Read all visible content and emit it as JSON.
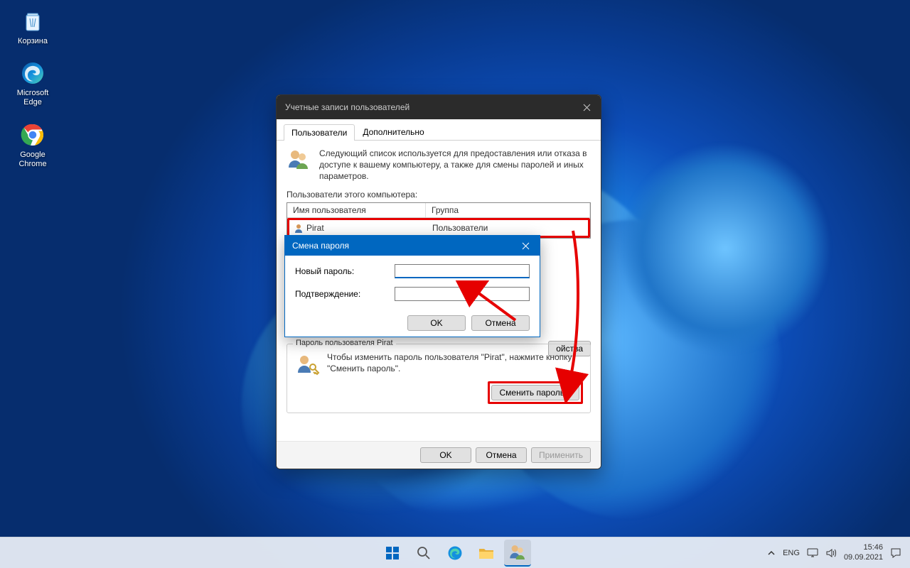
{
  "desktop": {
    "icons": [
      {
        "name": "recycle-bin",
        "label": "Корзина"
      },
      {
        "name": "edge",
        "label": "Microsoft Edge"
      },
      {
        "name": "chrome",
        "label": "Google Chrome"
      }
    ]
  },
  "mainWindow": {
    "title": "Учетные записи пользователей",
    "tabs": {
      "users": "Пользователи",
      "advanced": "Дополнительно"
    },
    "description": "Следующий список используется для предоставления или отказа в доступе к вашему компьютеру, а также для смены паролей и иных параметров.",
    "usersLabel": "Пользователи этого компьютера:",
    "columns": {
      "user": "Имя пользователя",
      "group": "Группа"
    },
    "rows": [
      {
        "user": "Pirat",
        "group": "Пользователи"
      }
    ],
    "propertiesBtn": "ойства",
    "passwordBox": {
      "title": "Пароль пользователя Pirat",
      "text": "Чтобы изменить пароль пользователя \"Pirat\", нажмите кнопку \"Сменить пароль\".",
      "button": "Сменить пароль..."
    },
    "bottom": {
      "ok": "OK",
      "cancel": "Отмена",
      "apply": "Применить"
    }
  },
  "passwordDialog": {
    "title": "Смена пароля",
    "newPassword": "Новый пароль:",
    "confirm": "Подтверждение:",
    "ok": "OK",
    "cancel": "Отмена"
  },
  "taskbar": {
    "lang": "ENG",
    "time": "15:46",
    "date": "09.09.2021"
  }
}
